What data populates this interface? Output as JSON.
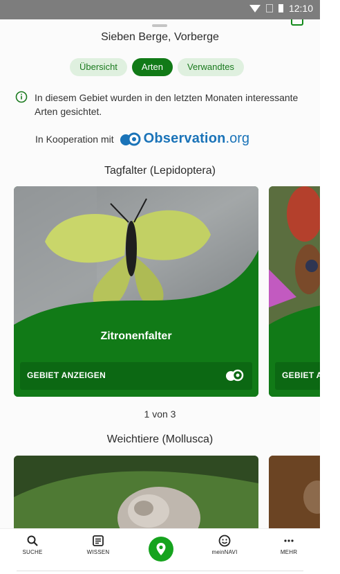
{
  "status": {
    "time": "12:10"
  },
  "header": {
    "title": "Sieben Berge, Vorberge"
  },
  "tabs": [
    {
      "label": "Übersicht",
      "active": false
    },
    {
      "label": "Arten",
      "active": true
    },
    {
      "label": "Verwandtes",
      "active": false
    }
  ],
  "info": {
    "text": "In diesem Gebiet wurden in den letzten Monaten interessante Arten gesichtet."
  },
  "coop": {
    "prefix": "In Kooperation mit",
    "brand": "Observation",
    "tld": ".org"
  },
  "sections": [
    {
      "title": "Tagfalter (Lepidoptera)",
      "cards": [
        {
          "name": "Zitronenfalter",
          "action": "GEBIET ANZEIGEN"
        },
        {
          "name": "",
          "action": "GEBIET ANZEIGEN"
        }
      ],
      "pager": "1 von 3"
    },
    {
      "title": "Weichtiere (Mollusca)"
    }
  ],
  "bottom_nav": [
    {
      "label": "SUCHE",
      "icon": "search-icon"
    },
    {
      "label": "WISSEN",
      "icon": "article-icon"
    },
    {
      "label": "",
      "icon": "map-pin-icon"
    },
    {
      "label": "meinNAVI",
      "icon": "smiley-icon"
    },
    {
      "label": "MEHR",
      "icon": "more-icon"
    }
  ],
  "colors": {
    "brand_green": "#117a17",
    "chip_bg": "#dff0df",
    "observation_blue": "#1a73b8"
  }
}
